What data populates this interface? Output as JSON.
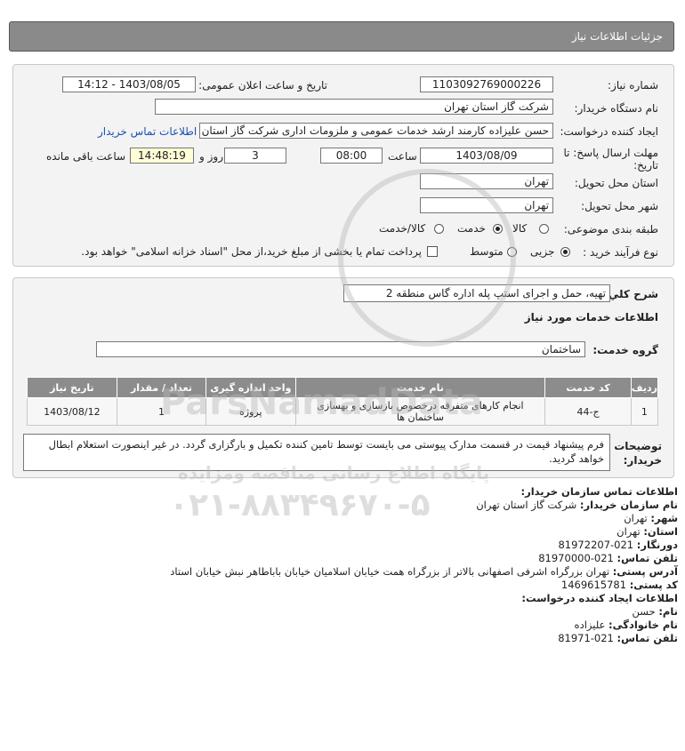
{
  "header": {
    "title": "جزئیات اطلاعات نیاز"
  },
  "form": {
    "need_number_label": "شماره نیاز:",
    "need_number": "1103092769000226",
    "announce_label": "تاریخ و ساعت اعلان عمومی:",
    "announce_value": "1403/08/05 - 14:12",
    "buyer_org_label": "نام دستگاه خریدار:",
    "buyer_org": "شرکت گاز استان تهران",
    "creator_label": "ایجاد کننده درخواست:",
    "creator": "حسن علیزاده کارمند ارشد خدمات عمومی و ملزومات اداری شرکت گاز استان تهران",
    "contact_link": "اطلاعات تماس خریدار",
    "deadline_label_1": "مهلت ارسال پاسخ: تا",
    "deadline_label_2": "تاریخ:",
    "deadline_date": "1403/08/09",
    "time_label": "ساعت",
    "deadline_time": "08:00",
    "days": "3",
    "days_label": "روز و",
    "remaining_time": "14:48:19",
    "remaining_label": "ساعت باقی مانده",
    "province_label": "استان محل تحویل:",
    "province": "تهران",
    "city_label": "شهر محل تحویل:",
    "city": "تهران",
    "category_label": "طبقه بندی موضوعی:",
    "category_options": [
      "کالا",
      "خدمت",
      "کالا/خدمت"
    ],
    "category_selected": "خدمت",
    "process_label": "نوع فرآیند خرید :",
    "process_options": [
      "جزیی",
      "متوسط"
    ],
    "process_selected": "جزیی",
    "payment_note": "پرداخت تمام یا بخشی از مبلغ خرید،از محل \"اسناد خزانه اسلامی\" خواهد بود."
  },
  "description": {
    "label": "شرح کلي نياز:",
    "value": "تهیه، حمل و اجرای استپ پله اداره گاس منطقه 2",
    "services_heading": "اطلاعات خدمات مورد نیاز",
    "group_label": "گروه خدمت:",
    "group_value": "ساختمان"
  },
  "table": {
    "headers": [
      "ردیف",
      "کد خدمت",
      "نام خدمت",
      "واحد اندازه گیری",
      "تعداد / مقدار",
      "تاریخ نیاز"
    ],
    "rows": [
      [
        "1",
        "ج-44",
        "انجام کارهای متفرقه درخصوص بازسازی و بهسازی ساختمان ها",
        "پروژه",
        "1",
        "1403/08/12"
      ]
    ]
  },
  "notes": {
    "label_1": "توضیحات",
    "label_2": "خریدار:",
    "text": "فرم پیشنهاد قیمت در قسمت مدارک پیوستی می بایست توسط تامین کننده تکمیل و بارگزاری گردد. در غیر اینصورت استعلام ابطال خواهد گردید."
  },
  "contact": {
    "org_heading": "اطلاعات تماس سازمان خریدار:",
    "org_name_label": "نام سازمان خریدار:",
    "org_name": "شرکت گاز استان تهران",
    "city_label": "شهر:",
    "city": "تهران",
    "province_label": "استان:",
    "province": "تهران",
    "fax_label": "دورنگار:",
    "fax": "81972207-021",
    "phone_label": "تلفن تماس:",
    "phone": "81970000-021",
    "address_label": "آدرس پستی:",
    "address": "تهران بزرگراه اشرفی اصفهانی بالاتر از بزرگراه همت خیابان اسلامیان خیابان باباطاهر نبش خیابان استاد",
    "postal_label": "کد پستی:",
    "postal": "1469615781",
    "creator_heading": "اطلاعات ایجاد کننده درخواست:",
    "first_name_label": "نام:",
    "first_name": "حسن",
    "last_name_label": "نام خانوادگی:",
    "last_name": "علیزاده",
    "creator_phone_label": "تلفن تماس:",
    "creator_phone": "81971-021"
  },
  "watermark": {
    "brand": "ParsNamadData",
    "tagline": "پایگاه اطلاع رسانی مناقصه ومزایده",
    "phone": "۰۲۱-۸۸۳۴۹۶۷۰-۵"
  }
}
